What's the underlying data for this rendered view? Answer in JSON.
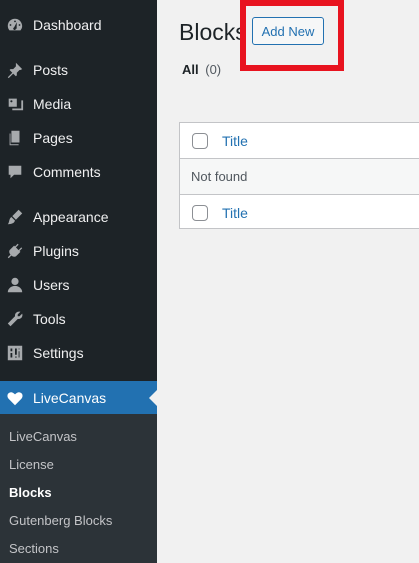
{
  "sidebar": {
    "items": [
      {
        "label": "Dashboard",
        "icon": "dashboard-icon"
      },
      {
        "label": "Posts",
        "icon": "pin-icon"
      },
      {
        "label": "Media",
        "icon": "media-icon"
      },
      {
        "label": "Pages",
        "icon": "pages-icon"
      },
      {
        "label": "Comments",
        "icon": "comment-icon"
      },
      {
        "label": "Appearance",
        "icon": "brush-icon"
      },
      {
        "label": "Plugins",
        "icon": "plug-icon"
      },
      {
        "label": "Users",
        "icon": "user-icon"
      },
      {
        "label": "Tools",
        "icon": "wrench-icon"
      },
      {
        "label": "Settings",
        "icon": "settings-icon"
      },
      {
        "label": "LiveCanvas",
        "icon": "heart-icon"
      }
    ],
    "submenu": [
      "LiveCanvas",
      "License",
      "Blocks",
      "Gutenberg Blocks",
      "Sections"
    ],
    "active_item": "LiveCanvas",
    "current_sub": "Blocks"
  },
  "main": {
    "title": "Blocks",
    "add_new_label": "Add New",
    "filter": {
      "label": "All",
      "count": "(0)"
    },
    "table": {
      "column_title": "Title",
      "empty_text": "Not found"
    }
  },
  "colors": {
    "sidebar_bg": "#1d2327",
    "accent": "#2271b1",
    "highlight": "#e8131f"
  }
}
